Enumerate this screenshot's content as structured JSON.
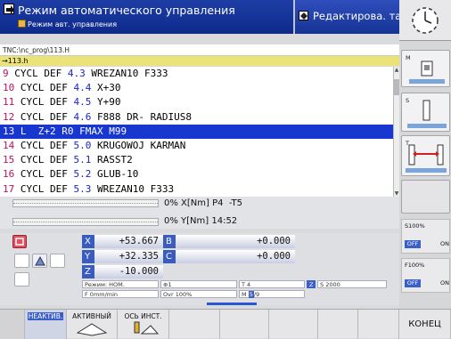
{
  "header": {
    "mode_title": "Режим автоматического управления",
    "mode_subtitle": "Режим авт. управления",
    "edit_title": "Редактирова. таб..."
  },
  "editor": {
    "path": "TNC:\\nc_prog\\113.H",
    "file": "→113.h",
    "lines": [
      {
        "n": "9",
        "pre": " CYCL DEF ",
        "v": "4.3",
        "post": " WREZAN10 F333"
      },
      {
        "n": "10",
        "pre": " CYCL DEF ",
        "v": "4.4",
        "post": " X+30"
      },
      {
        "n": "11",
        "pre": " CYCL DEF ",
        "v": "4.5",
        "post": " Y+90"
      },
      {
        "n": "12",
        "pre": " CYCL DEF ",
        "v": "4.6",
        "post": " F888 DR- RADIUS8"
      },
      {
        "n": "13",
        "pre": " L  Z+2 R0 FMAX M99",
        "v": "",
        "post": ""
      },
      {
        "n": "14",
        "pre": " CYCL DEF ",
        "v": "5.0",
        "post": " KRUGOWOJ KARMAN"
      },
      {
        "n": "15",
        "pre": " CYCL DEF ",
        "v": "5.1",
        "post": " RASST2"
      },
      {
        "n": "16",
        "pre": " CYCL DEF ",
        "v": "5.2",
        "post": " GLUB-10"
      },
      {
        "n": "17",
        "pre": " CYCL DEF ",
        "v": "5.3",
        "post": " WREZAN10 F333"
      }
    ]
  },
  "status": {
    "line1": "0% X[Nm] P4  -T5",
    "line2": "0% Y[Nm] 14:52"
  },
  "axes": [
    {
      "label": "X",
      "value": "+53.667"
    },
    {
      "label": "Y",
      "value": "+32.335"
    },
    {
      "label": "Z",
      "value": "-10.000"
    },
    {
      "label": "B",
      "value": "+0.000"
    },
    {
      "label": "C",
      "value": "+0.000"
    }
  ],
  "info": {
    "mode": "Режим: НОМ.",
    "feed": "F 0mm/min",
    "spindle_icon": "⊕1",
    "ovr": "Ovr 100%",
    "tool": "T 4",
    "tool_z": "Z",
    "speed": "S 2000",
    "mfunc_prefix": "M ",
    "mfunc_a": "5",
    "mfunc_b": "/9"
  },
  "right": {
    "m_label": "M",
    "s_label": "S",
    "t_label": "T",
    "s_override": "S100%",
    "f_override": "F100%",
    "off": "OFF",
    "on": "ON"
  },
  "softkeys": {
    "inactive": "НЕАКТИВ.",
    "active": "АКТИВНЫЙ",
    "tool_axis": "ОСЬ ИНСТ.",
    "end": "КОНЕЦ"
  }
}
